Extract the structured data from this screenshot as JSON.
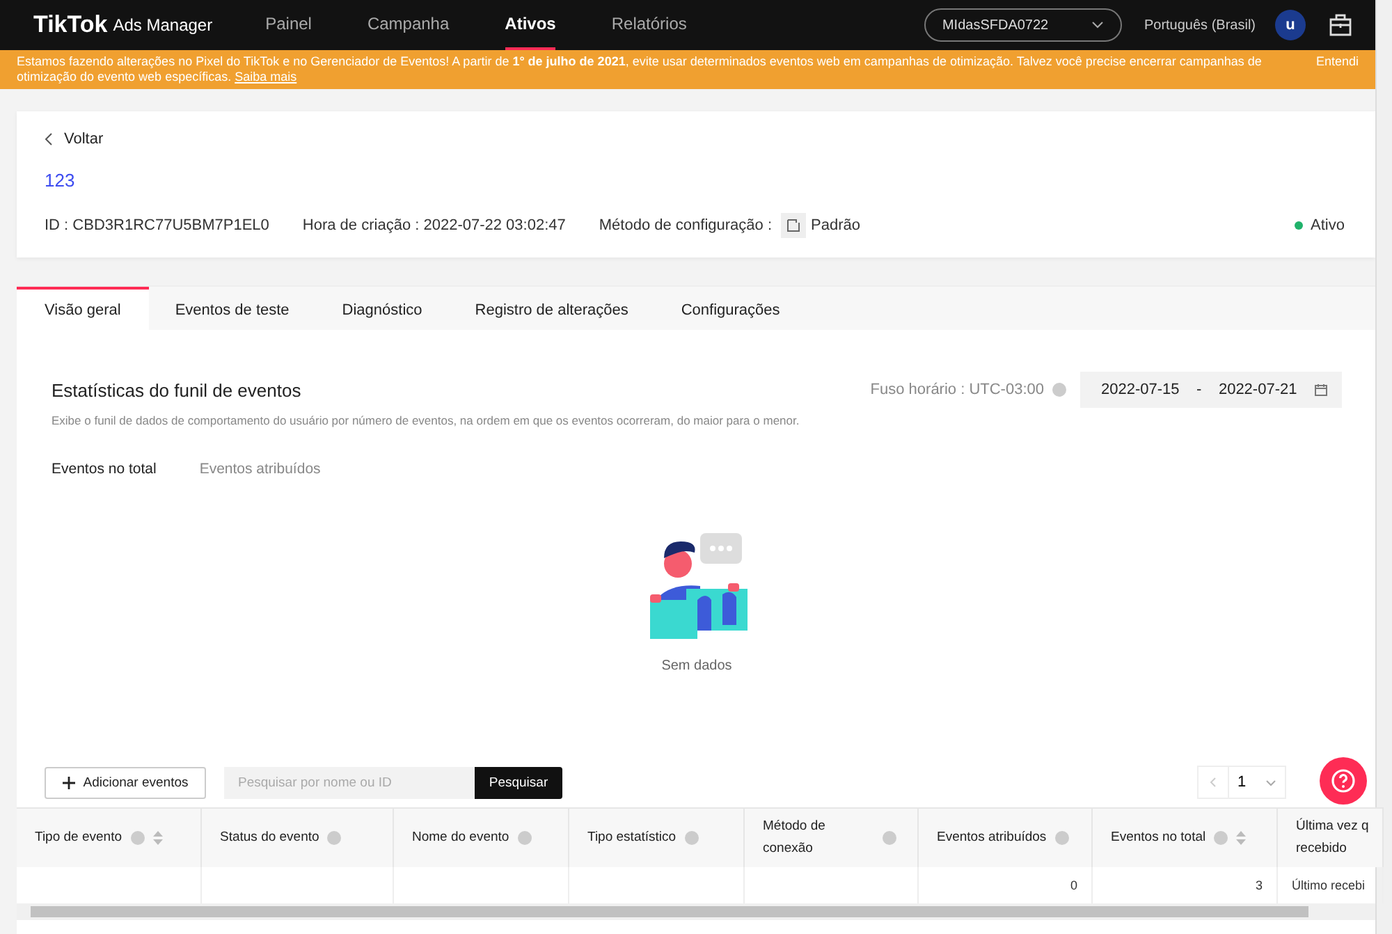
{
  "nav": {
    "logo": "TikTok",
    "logo_suffix": "Ads Manager",
    "items": [
      {
        "label": "Painel",
        "selected": false
      },
      {
        "label": "Campanha",
        "selected": false
      },
      {
        "label": "Ativos",
        "selected": true
      },
      {
        "label": "Relatórios",
        "selected": false
      }
    ],
    "account": "MIdasSFDA0722",
    "language": "Português (Brasil)",
    "avatar": "u"
  },
  "banner": {
    "text": "Estamos fazendo alterações no Pixel do TikTok e no Gerenciador de Eventos! A partir de **1° de julho de 2021**, evite usar determinados eventos web em campanhas de otimização. Talvez você precise encerrar campanhas de otimização do evento web específicas.",
    "link": "Saiba mais",
    "right": "Entendi"
  },
  "header": {
    "back": "Voltar",
    "name": "123",
    "id": "ID : CBD3R1RC77U5BM7P1EL0",
    "created": "Hora de criação : 2022-07-22 03:02:47",
    "method_label": "Método de configuração :",
    "method": "Padrão",
    "status": "Ativo"
  },
  "tabs": [
    {
      "label": "Visão geral",
      "selected": true
    },
    {
      "label": "Eventos de teste",
      "selected": false
    },
    {
      "label": "Diagnóstico",
      "selected": false
    },
    {
      "label": "Registro de alterações",
      "selected": false
    },
    {
      "label": "Configurações",
      "selected": false
    }
  ],
  "funnel": {
    "title": "Estatísticas do funil de eventos",
    "description": "Exibe o funil de dados de comportamento do usuário por número de eventos, na ordem em que os eventos ocorreram, do maior para o menor.",
    "timezone": "Fuso horário : UTC-03:00",
    "date_from": "2022-07-15",
    "date_sep": "-",
    "date_to": "2022-07-21",
    "subtabs": [
      {
        "label": "Eventos no total",
        "selected": true
      },
      {
        "label": "Eventos atribuídos",
        "selected": false
      }
    ],
    "empty": "Sem dados"
  },
  "toolbar": {
    "add": "Adicionar eventos",
    "search_placeholder": "Pesquisar por nome ou ID",
    "search_button": "Pesquisar",
    "page": "1"
  },
  "table": {
    "columns": [
      {
        "label": "Tipo de evento",
        "sortable": true
      },
      {
        "label": "Status do evento",
        "sortable": false
      },
      {
        "label": "Nome do evento",
        "sortable": false
      },
      {
        "label": "Tipo estatístico",
        "sortable": false
      },
      {
        "label": "Método de conexão",
        "sortable": false
      },
      {
        "label": "Eventos atribuídos",
        "sortable": false
      },
      {
        "label": "Eventos no total",
        "sortable": true
      },
      {
        "label": "Última vez q recebido",
        "sortable": false
      }
    ],
    "rows": [
      {
        "cells": [
          "",
          "",
          "",
          "",
          "",
          "0",
          "3",
          "Último recebi"
        ]
      }
    ]
  }
}
